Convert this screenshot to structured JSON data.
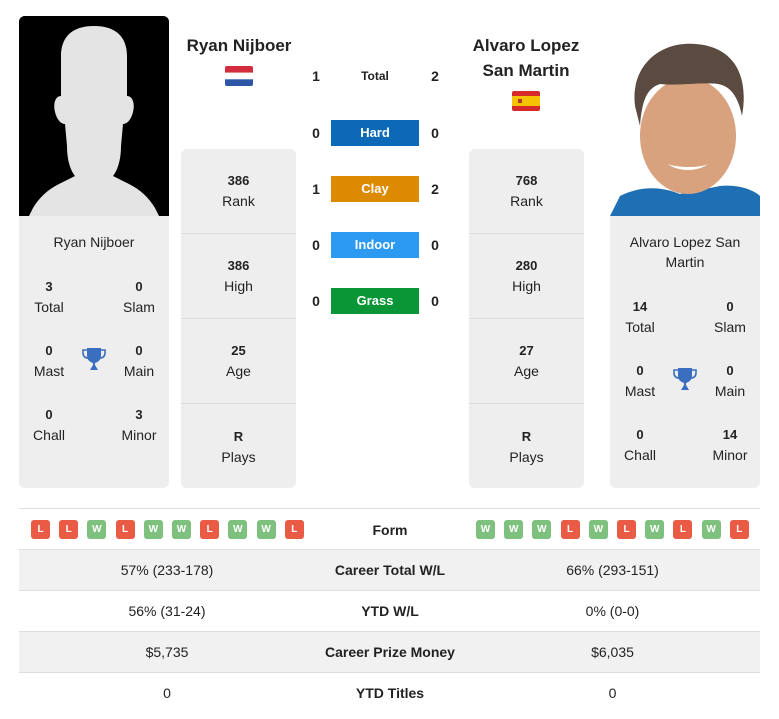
{
  "player_left": {
    "name": "Ryan Nijboer",
    "country_flag": "netherlands-flag",
    "card_name": "Ryan Nijboer",
    "titles": {
      "total": {
        "value": "3",
        "label": "Total"
      },
      "slam": {
        "value": "0",
        "label": "Slam"
      },
      "mast": {
        "value": "0",
        "label": "Mast"
      },
      "main": {
        "value": "0",
        "label": "Main"
      },
      "chall": {
        "value": "0",
        "label": "Chall"
      },
      "minor": {
        "value": "3",
        "label": "Minor"
      }
    },
    "stats": [
      {
        "value": "386",
        "label": "Rank"
      },
      {
        "value": "386",
        "label": "High"
      },
      {
        "value": "25",
        "label": "Age"
      },
      {
        "value": "R",
        "label": "Plays"
      }
    ],
    "form": [
      "L",
      "L",
      "W",
      "L",
      "W",
      "W",
      "L",
      "W",
      "W",
      "L"
    ]
  },
  "player_right": {
    "name_line1": "Alvaro Lopez",
    "name_line2": "San Martin",
    "country_flag": "spain-flag",
    "card_name_line1": "Alvaro Lopez San",
    "card_name_line2": "Martin",
    "titles": {
      "total": {
        "value": "14",
        "label": "Total"
      },
      "slam": {
        "value": "0",
        "label": "Slam"
      },
      "mast": {
        "value": "0",
        "label": "Mast"
      },
      "main": {
        "value": "0",
        "label": "Main"
      },
      "chall": {
        "value": "0",
        "label": "Chall"
      },
      "minor": {
        "value": "14",
        "label": "Minor"
      }
    },
    "stats": [
      {
        "value": "768",
        "label": "Rank"
      },
      {
        "value": "280",
        "label": "High"
      },
      {
        "value": "27",
        "label": "Age"
      },
      {
        "value": "R",
        "label": "Plays"
      }
    ],
    "form": [
      "W",
      "W",
      "W",
      "L",
      "W",
      "L",
      "W",
      "L",
      "W",
      "L"
    ]
  },
  "h2h": [
    {
      "label": "Total",
      "left": "1",
      "right": "2",
      "color": ""
    },
    {
      "label": "Hard",
      "left": "0",
      "right": "0",
      "color": "#0b69b8"
    },
    {
      "label": "Clay",
      "left": "1",
      "right": "2",
      "color": "#dc8b00"
    },
    {
      "label": "Indoor",
      "left": "0",
      "right": "0",
      "color": "#2c9af0"
    },
    {
      "label": "Grass",
      "left": "0",
      "right": "0",
      "color": "#0a9637"
    }
  ],
  "form_label": "Form",
  "comparison": [
    {
      "left": "57% (233-178)",
      "label": "Career Total W/L",
      "right": "66% (293-151)"
    },
    {
      "left": "56% (31-24)",
      "label": "YTD W/L",
      "right": "0% (0-0)"
    },
    {
      "left": "$5,735",
      "label": "Career Prize Money",
      "right": "$6,035"
    },
    {
      "left": "0",
      "label": "YTD Titles",
      "right": "0"
    }
  ],
  "colors": {
    "win": "#7ec07e",
    "loss": "#ea5b45",
    "trophy": "#3a6fbf",
    "card_bg": "#eeeeee"
  }
}
